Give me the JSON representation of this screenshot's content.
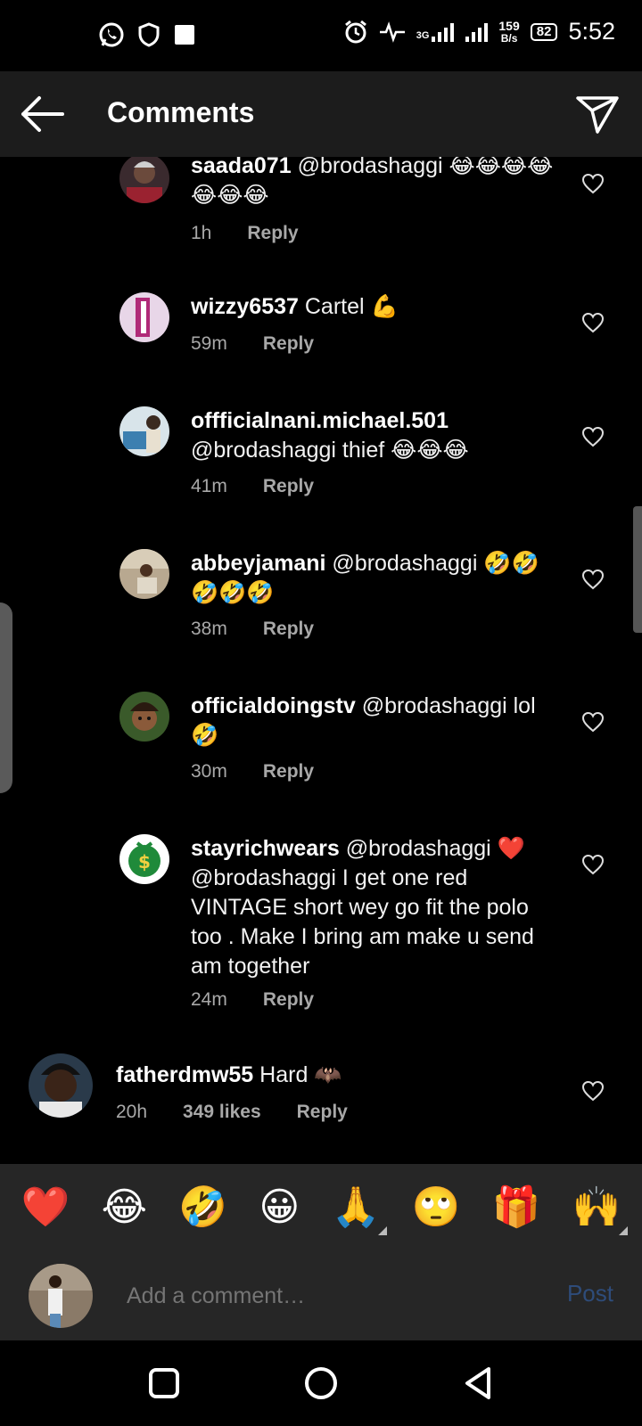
{
  "status_bar": {
    "time": "5:52",
    "network_speed_top": "159",
    "network_speed_bottom": "B/s",
    "battery": "82",
    "network_type": "3G"
  },
  "header": {
    "title": "Comments"
  },
  "comments": [
    {
      "user": "saada071",
      "text": "@brodashaggi 😂😂😂😂😂😂😂",
      "time": "1h",
      "reply_label": "Reply"
    },
    {
      "user": "wizzy6537",
      "text": "Cartel 💪",
      "time": "59m",
      "reply_label": "Reply"
    },
    {
      "user": "offficialnani.michael.501",
      "text": "@brodashaggi thief 😂😂😂",
      "time": "41m",
      "reply_label": "Reply"
    },
    {
      "user": "abbeyjamani",
      "text": "@brodashaggi 🤣🤣🤣🤣🤣",
      "time": "38m",
      "reply_label": "Reply"
    },
    {
      "user": "officialdoingstv",
      "text": "@brodashaggi lol 🤣",
      "time": "30m",
      "reply_label": "Reply"
    },
    {
      "user": "stayrichwears",
      "text": "@brodashaggi ❤️@brodashaggi I get one red VINTAGE short wey go fit the polo too . Make I bring am make u send am together",
      "time": "24m",
      "reply_label": "Reply"
    }
  ],
  "top_comment": {
    "user": "fatherdmw55",
    "text": "Hard 🦇",
    "time": "20h",
    "likes": "349 likes",
    "reply_label": "Reply"
  },
  "emoji_bar": [
    "❤️",
    "😂",
    "🤣",
    "😀",
    "🙏",
    "🙄",
    "🎁",
    "🙌"
  ],
  "composer": {
    "placeholder": "Add a comment…",
    "post_label": "Post"
  },
  "colors": {
    "background": "#000000",
    "header_bg": "#1c1c1c",
    "composer_bg": "#262626",
    "meta_text": "#a8a8a8",
    "post_disabled": "#2e4c7a"
  }
}
